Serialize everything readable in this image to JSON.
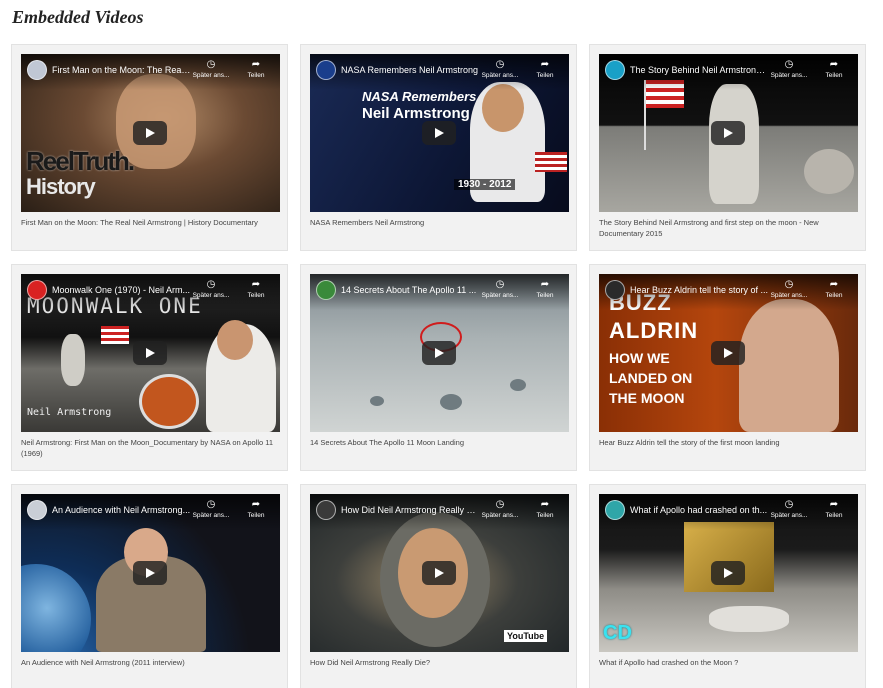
{
  "page": {
    "title": "Embedded Videos"
  },
  "controls": {
    "watch_later_label": "Später ans...",
    "share_label": "Teilen"
  },
  "videos": [
    {
      "overlay_title": "First Man on the Moon: The Real ...",
      "caption": "First Man on the Moon: The Real Neil Armstrong | History Documentary",
      "thumb_text": [
        "ReelTruth.",
        "History"
      ]
    },
    {
      "overlay_title": "NASA Remembers Neil Armstrong",
      "caption": "NASA Remembers Neil Armstrong",
      "thumb_text": [
        "NASA Remembers",
        "Neil Armstrong",
        "1930 - 2012"
      ]
    },
    {
      "overlay_title": "The Story Behind Neil Armstrong ...",
      "caption": "The Story Behind Neil Armstrong and first step on the moon - New Documentary 2015",
      "thumb_text": []
    },
    {
      "overlay_title": "Moonwalk One (1970) - Neil Arm...",
      "caption": "Neil Armstrong: First Man on the Moon_Documentary by NASA on Apollo 11 (1969)",
      "thumb_text": [
        "MOONWALK ONE",
        "Neil Armstrong"
      ]
    },
    {
      "overlay_title": "14 Secrets About The Apollo 11 ...",
      "caption": "14 Secrets About The Apollo 11 Moon Landing",
      "thumb_text": []
    },
    {
      "overlay_title": "Hear Buzz Aldrin tell the story of ...",
      "caption": "Hear Buzz Aldrin tell the story of the first moon landing",
      "thumb_text": [
        "BUZZ",
        "ALDRIN",
        "HOW WE",
        "LANDED ON",
        "THE MOON"
      ]
    },
    {
      "overlay_title": "An Audience with Neil Armstrong...",
      "caption": "An Audience with Neil Armstrong (2011 interview)",
      "thumb_text": []
    },
    {
      "overlay_title": "How Did Neil Armstrong Really Di...",
      "caption": "How Did Neil Armstrong Really Die?",
      "thumb_text": [
        "YouTube"
      ]
    },
    {
      "overlay_title": "What if Apollo had crashed on th...",
      "caption": "What if Apollo had crashed on the Moon ?",
      "thumb_text": [
        "CD"
      ]
    }
  ]
}
